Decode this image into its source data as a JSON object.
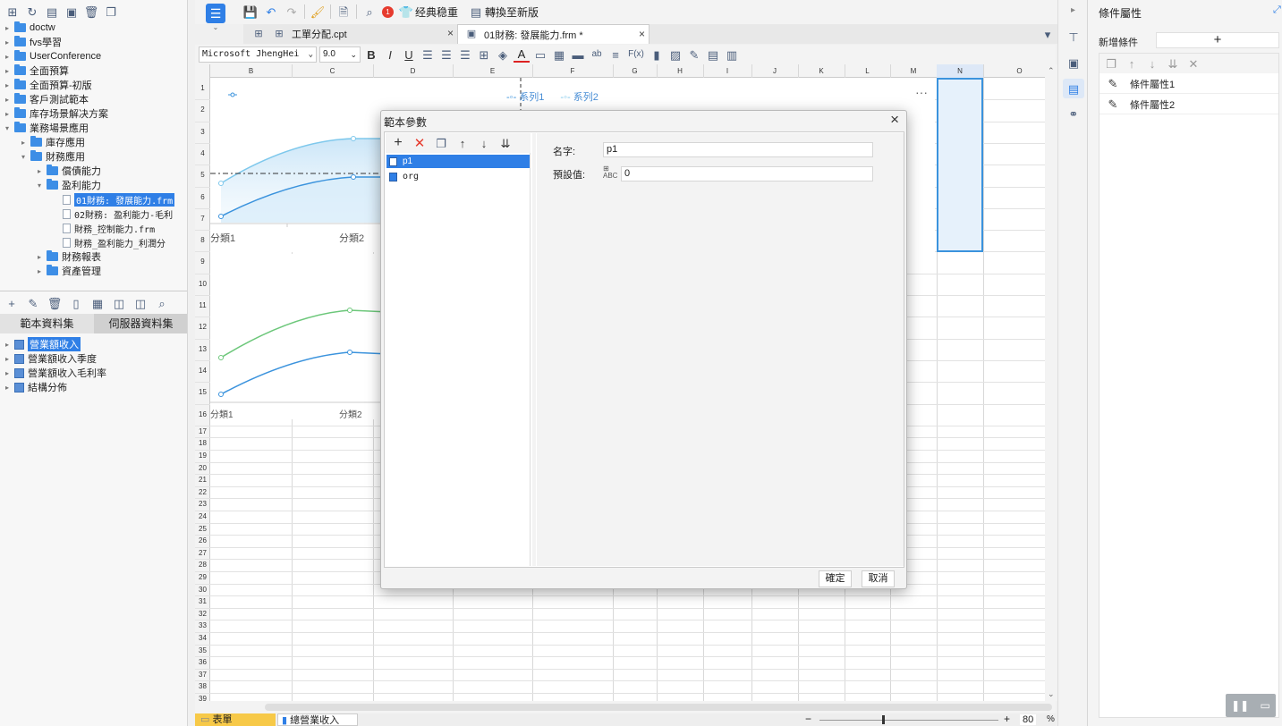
{
  "left_tree": {
    "items": [
      {
        "label": "doctw",
        "depth": 0,
        "type": "folder",
        "arrow": "▸"
      },
      {
        "label": "fvs學習",
        "depth": 0,
        "type": "folder",
        "arrow": "▸"
      },
      {
        "label": "UserConference",
        "depth": 0,
        "type": "folder",
        "arrow": "▸"
      },
      {
        "label": "全面預算",
        "depth": 0,
        "type": "folder",
        "arrow": "▸"
      },
      {
        "label": "全面預算-初版",
        "depth": 0,
        "type": "folder",
        "arrow": "▸"
      },
      {
        "label": "客戶測試範本",
        "depth": 0,
        "type": "folder",
        "arrow": "▸"
      },
      {
        "label": "库存场景解决方案",
        "depth": 0,
        "type": "folder",
        "arrow": "▸"
      },
      {
        "label": "業務場景應用",
        "depth": 0,
        "type": "folder",
        "arrow": "▾"
      },
      {
        "label": "庫存應用",
        "depth": 1,
        "type": "folder",
        "arrow": "▸"
      },
      {
        "label": "財務應用",
        "depth": 1,
        "type": "folder",
        "arrow": "▾"
      },
      {
        "label": "償債能力",
        "depth": 2,
        "type": "folder",
        "arrow": "▸"
      },
      {
        "label": "盈利能力",
        "depth": 2,
        "type": "folder",
        "arrow": "▾"
      },
      {
        "label": "01財務: 發展能力.frm",
        "depth": 3,
        "type": "file",
        "arrow": "",
        "selected": true
      },
      {
        "label": "02財務: 盈利能力-毛利",
        "depth": 3,
        "type": "file",
        "arrow": ""
      },
      {
        "label": "財務_控制能力.frm",
        "depth": 3,
        "type": "file",
        "arrow": ""
      },
      {
        "label": "財務_盈利能力_利潤分",
        "depth": 3,
        "type": "file",
        "arrow": ""
      },
      {
        "label": "財務報表",
        "depth": 2,
        "type": "folder",
        "arrow": "▸"
      },
      {
        "label": "資產管理",
        "depth": 2,
        "type": "folder",
        "arrow": "▸"
      }
    ]
  },
  "dataset_tabs": {
    "template": "範本資料集",
    "server": "伺服器資料集"
  },
  "datasets": [
    {
      "label": "營業額收入",
      "selected": true
    },
    {
      "label": "營業額收入季度"
    },
    {
      "label": "營業額收入毛利率"
    },
    {
      "label": "結構分佈"
    }
  ],
  "toolbar": {
    "classic": "经典稳重",
    "switch_new": "轉換至新版",
    "badge": "1"
  },
  "tabs": [
    {
      "label": "工單分配.cpt",
      "active": false
    },
    {
      "label": "01財務: 發展能力.frm *",
      "active": true
    }
  ],
  "format_bar": {
    "font": "Microsoft JhengHei",
    "size": "9.0",
    "bold": "B",
    "italic": "I",
    "underline": "U",
    "fx": "F(x)"
  },
  "columns": [
    "B",
    "C",
    "D",
    "E",
    "F",
    "G",
    "H",
    "I",
    "J",
    "K",
    "L",
    "M",
    "N",
    "O"
  ],
  "rows": [
    "1",
    "2",
    "3",
    "4",
    "5",
    "6",
    "7",
    "8",
    "9",
    "10",
    "11",
    "12",
    "13",
    "14",
    "15",
    "16",
    "17",
    "18",
    "19",
    "20",
    "21",
    "22",
    "23",
    "24",
    "25",
    "26",
    "27",
    "28",
    "29",
    "30",
    "31",
    "32",
    "33",
    "34",
    "35",
    "36",
    "37",
    "38",
    "39"
  ],
  "chart1": {
    "legend": [
      "系列1",
      "系列2"
    ],
    "categories": [
      "分類1",
      "分類2"
    ]
  },
  "chart2": {
    "categories": [
      "分類1",
      "分類2"
    ]
  },
  "dialog": {
    "title": "範本參數",
    "params": [
      {
        "label": "p1",
        "selected": true
      },
      {
        "label": "org"
      }
    ],
    "name_label": "名字:",
    "name_value": "p1",
    "default_label": "預設值:",
    "default_value": "0",
    "ok": "確定",
    "cancel": "取消"
  },
  "right_panel": {
    "title": "條件屬性",
    "add_label": "新增條件",
    "add_symbol": "+",
    "items": [
      "條件屬性1",
      "條件屬性2"
    ]
  },
  "sheet_tabs": [
    "表單",
    "總營業收入"
  ],
  "zoom": {
    "value": "80",
    "unit": "%",
    "minus": "−",
    "plus": "+"
  }
}
